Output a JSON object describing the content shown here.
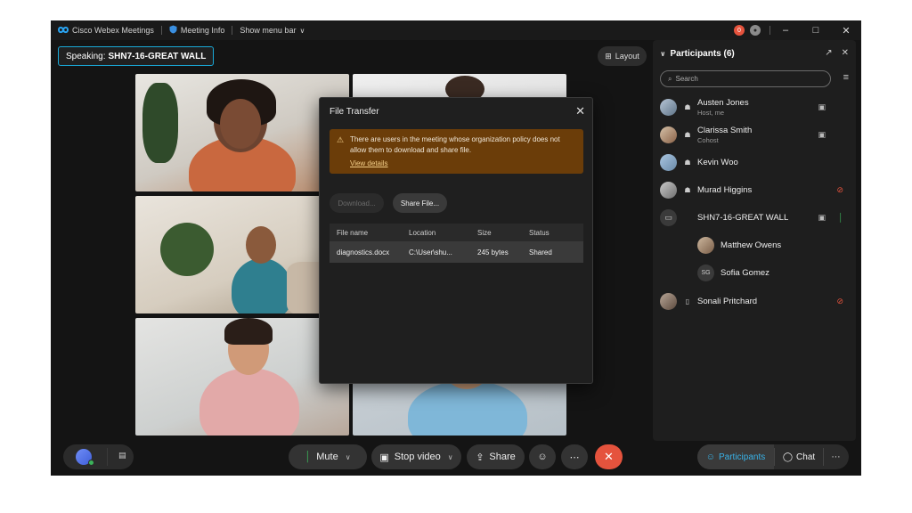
{
  "titlebar": {
    "app_name": "Cisco Webex Meetings",
    "meeting_info": "Meeting Info",
    "show_menu": "Show menu bar",
    "notif_count": "0"
  },
  "speaking": {
    "prefix": "Speaking:",
    "name": "SHN7-16-GREAT WALL"
  },
  "layout_label": "Layout",
  "dialog": {
    "title": "File Transfer",
    "warning": "There are users in the meeting whose organization policy does not allow them to download and share file.",
    "view_details": "View details",
    "download_label": "Download...",
    "share_label": "Share File...",
    "columns": [
      "File name",
      "Location",
      "Size",
      "Status"
    ],
    "rows": [
      [
        "diagnostics.docx",
        "C:\\User\\shu...",
        "245 bytes",
        "Shared"
      ]
    ]
  },
  "panel": {
    "title": "Participants (6)",
    "search_placeholder": "Search",
    "participants": [
      {
        "name": "Austen Jones",
        "sub": "Host, me",
        "mic": "none",
        "cam": true
      },
      {
        "name": "Clarissa Smith",
        "sub": "Cohost",
        "mic": "none",
        "cam": true
      },
      {
        "name": "Kevin Woo",
        "sub": "",
        "mic": "none",
        "cam": false
      },
      {
        "name": "Murad Higgins",
        "sub": "",
        "mic": "muted",
        "cam": false
      },
      {
        "name": "SHN7-16-GREAT WALL",
        "sub": "",
        "mic": "active",
        "cam": true
      },
      {
        "name": "Matthew Owens",
        "sub": "",
        "mic": "none",
        "cam": false
      },
      {
        "name": "Sofia Gomez",
        "initials": "SG",
        "sub": "",
        "mic": "none",
        "cam": false
      },
      {
        "name": "Sonali Pritchard",
        "sub": "",
        "mic": "muted",
        "cam": false
      }
    ]
  },
  "controls": {
    "mute": "Mute",
    "stop_video": "Stop video",
    "share": "Share",
    "participants": "Participants",
    "chat": "Chat"
  },
  "colors": {
    "accent": "#19a9d8",
    "leave": "#e5533d",
    "warning_bg": "#6b3d09",
    "mic_active": "#3bb35a"
  }
}
